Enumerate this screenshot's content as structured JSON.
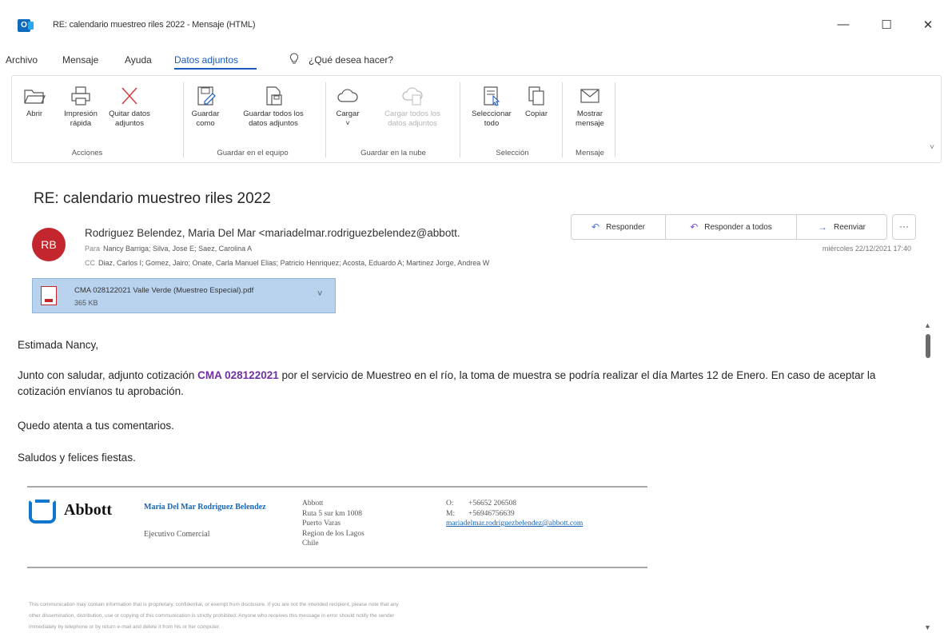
{
  "window": {
    "title": "RE: calendario muestreo riles 2022  -  Mensaje (HTML)",
    "minimize": "—",
    "maximize": "☐",
    "close": "✕"
  },
  "menu": {
    "tabs": [
      "Archivo",
      "Mensaje",
      "Ayuda",
      "Datos adjuntos"
    ],
    "search": "¿Qué desea hacer?"
  },
  "ribbon": {
    "groups": {
      "acciones": "Acciones",
      "guardar_equipo": "Guardar en el equipo",
      "guardar_nube": "Guardar en la nube",
      "seleccion": "Selección",
      "mensaje": "Mensaje"
    },
    "buttons": {
      "abrir": "Abrir",
      "impresion_1": "Impresión",
      "impresion_2": "rápida",
      "quitar_1": "Quitar datos",
      "quitar_2": "adjuntos",
      "guardar_como_1": "Guardar",
      "guardar_como_2": "como",
      "guardar_todos_1": "Guardar todos los",
      "guardar_todos_2": "datos adjuntos",
      "cargar": "Cargar",
      "cargar_todos_1": "Cargar todos los",
      "cargar_todos_2": "datos adjuntos",
      "seleccionar_1": "Seleccionar",
      "seleccionar_2": "todo",
      "copiar": "Copiar",
      "mostrar_1": "Mostrar",
      "mostrar_2": "mensaje"
    }
  },
  "message": {
    "subject": "RE: calendario muestreo riles 2022",
    "avatar": "RB",
    "sender": "Rodriguez Belendez, Maria Del Mar <mariadelmar.rodriguezbelendez@abbott.",
    "to_label": "Para",
    "to": "Nancy Barriga; Silva, Jose E; Saez, Carolina A",
    "cc_label": "CC",
    "cc": "Diaz, Carlos I; Gomez, Jairo; Onate, Carla Manuel Elias; Patricio Henriquez; Acosta, Eduardo A; Martinez Jorge, Andrea W",
    "date": "miércoles 22/12/2021 17:40",
    "actions": {
      "reply": "Responder",
      "reply_all": "Responder a todos",
      "forward": "Reenviar",
      "more": "···"
    },
    "attachment": {
      "name": "CMA 028122021 Valle Verde (Muestreo Especial).pdf",
      "size": "365 KB"
    },
    "body": {
      "greeting": "Estimada Nancy,",
      "p2_before": "Junto con saludar, adjunto cotización ",
      "p2_code": "CMA 028122021",
      "p2_after": " por el servicio de Muestreo en el río, la toma de muestra se podría realizar el día Martes 12 de Enero. En caso de aceptar la cotización envíanos tu aprobación.",
      "p3": "Quedo atenta a tus comentarios.",
      "p4": "Saludos y felices fiestas."
    },
    "signature": {
      "logo": "Abbott",
      "name": "Maria Del Mar Rodriguez Belendez",
      "title": "Ejecutivo Comercial",
      "address": [
        "Abbott",
        "Ruta 5 sur km 1008",
        "Puerto Varas",
        "Region de los Lagos",
        "Chile"
      ],
      "office_label": "O:",
      "office": "+56652 206508",
      "mobile_label": "M:",
      "mobile": "+56946756639",
      "email": "mariadelmar.rodriguezbelendez@abbott.com"
    },
    "disclaimer": [
      "This communication may contain information that is proprietary, confidential, or exempt from disclosure. If you are not the intended recipient, please note that any",
      "other dissemination, distribution, use or copying of this communication is strictly prohibited. Anyone who receives this message in error should notify the sender",
      "immediately by telephone or by return e-mail and delete it from his or her computer."
    ]
  }
}
